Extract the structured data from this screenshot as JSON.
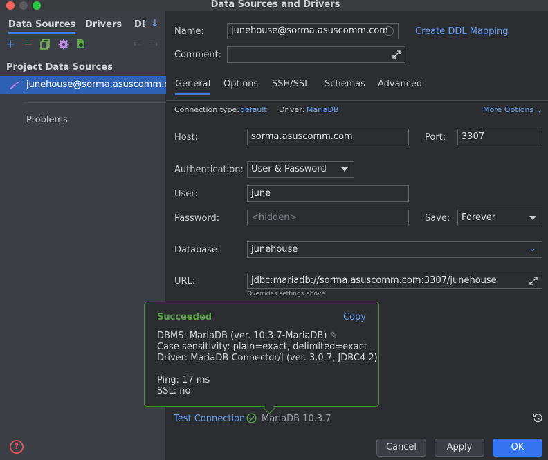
{
  "window": {
    "title": "Data Sources and Drivers"
  },
  "left": {
    "tabs": [
      "Data Sources",
      "Drivers",
      "DD"
    ],
    "section_title": "Project Data Sources",
    "selected_item": "junehouse@sorma.asuscomm.com",
    "problems": "Problems",
    "help_glyph": "?"
  },
  "form": {
    "name_label": "Name:",
    "name_value": "junehouse@sorma.asuscomm.com",
    "create_ddl": "Create DDL Mapping",
    "comment_label": "Comment:",
    "tabs": [
      "General",
      "Options",
      "SSH/SSL",
      "Schemas",
      "Advanced"
    ],
    "connection_type_label": "Connection type:",
    "connection_type_value": "default",
    "driver_label": "Driver:",
    "driver_value": "MariaDB",
    "more_options": "More Options",
    "host_label": "Host:",
    "host_value": "sorma.asuscomm.com",
    "port_label": "Port:",
    "port_value": "3307",
    "auth_label": "Authentication:",
    "auth_value": "User & Password",
    "user_label": "User:",
    "user_value": "june",
    "password_label": "Password:",
    "password_placeholder": "<hidden>",
    "save_label": "Save:",
    "save_value": "Forever",
    "database_label": "Database:",
    "database_value": "junehouse",
    "url_label": "URL:",
    "url_prefix": "jdbc:mariadb://sorma.asuscomm.com:3307/",
    "url_db": "junehouse",
    "url_note": "Overrides settings above"
  },
  "popup": {
    "status": "Succeeded",
    "copy": "Copy",
    "dbms": "DBMS: MariaDB (ver. 10.3.7-MariaDB)",
    "case": "Case sensitivity: plain=exact, delimited=exact",
    "driver": "Driver: MariaDB Connector/J (ver. 3.0.7, JDBC4.2)",
    "ping": "Ping: 17 ms",
    "ssl": "SSL: no"
  },
  "footer": {
    "test_connection": "Test Connection",
    "server_version": "MariaDB 10.3.7",
    "cancel": "Cancel",
    "apply": "Apply",
    "ok": "OK"
  },
  "colors": {
    "accent": "#3574f0",
    "link": "#5f9df2",
    "success": "#5aa34b",
    "selection": "#2f62b5"
  }
}
